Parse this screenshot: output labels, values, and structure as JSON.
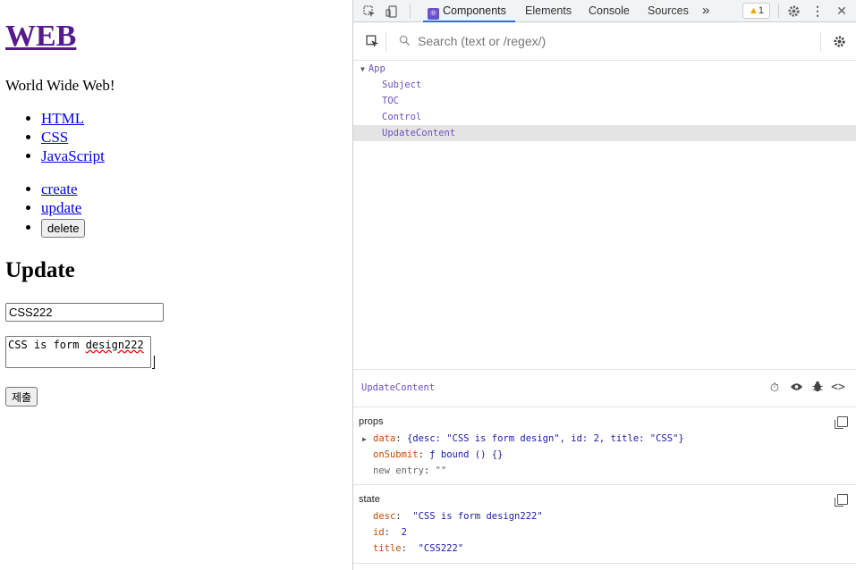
{
  "page": {
    "title": "WEB",
    "subtitle": "World Wide Web!",
    "toc": [
      "HTML",
      "CSS",
      "JavaScript"
    ],
    "controls": {
      "create": "create",
      "update": "update",
      "delete": "delete"
    },
    "form_heading": "Update",
    "title_value": "CSS222",
    "desc_value_prefix": "CSS is form ",
    "desc_value_misspelled": "design222",
    "submit_label": "제출"
  },
  "devtools": {
    "tabs": [
      "Components",
      "Elements",
      "Console",
      "Sources"
    ],
    "more_tabs": "»",
    "warning_count": "1",
    "search_placeholder": "Search (text or /regex/)",
    "tree": {
      "root": "App",
      "children": [
        "Subject",
        "TOC",
        "Control",
        "UpdateContent"
      ]
    },
    "selected_component": "UpdateContent",
    "props": {
      "title": "props",
      "data_key": "data",
      "data_value": "{desc: \"CSS is form design\", id: 2, title: \"CSS\"}",
      "onsubmit_key": "onSubmit",
      "onsubmit_value": "ƒ bound () {}",
      "new_entry_key": "new entry",
      "new_entry_value": "\"\""
    },
    "state": {
      "title": "state",
      "desc_key": "desc",
      "desc_value": "\"CSS is form design222\"",
      "id_key": "id",
      "id_value": "2",
      "title_key": "title",
      "title_value": "\"CSS222\""
    }
  }
}
